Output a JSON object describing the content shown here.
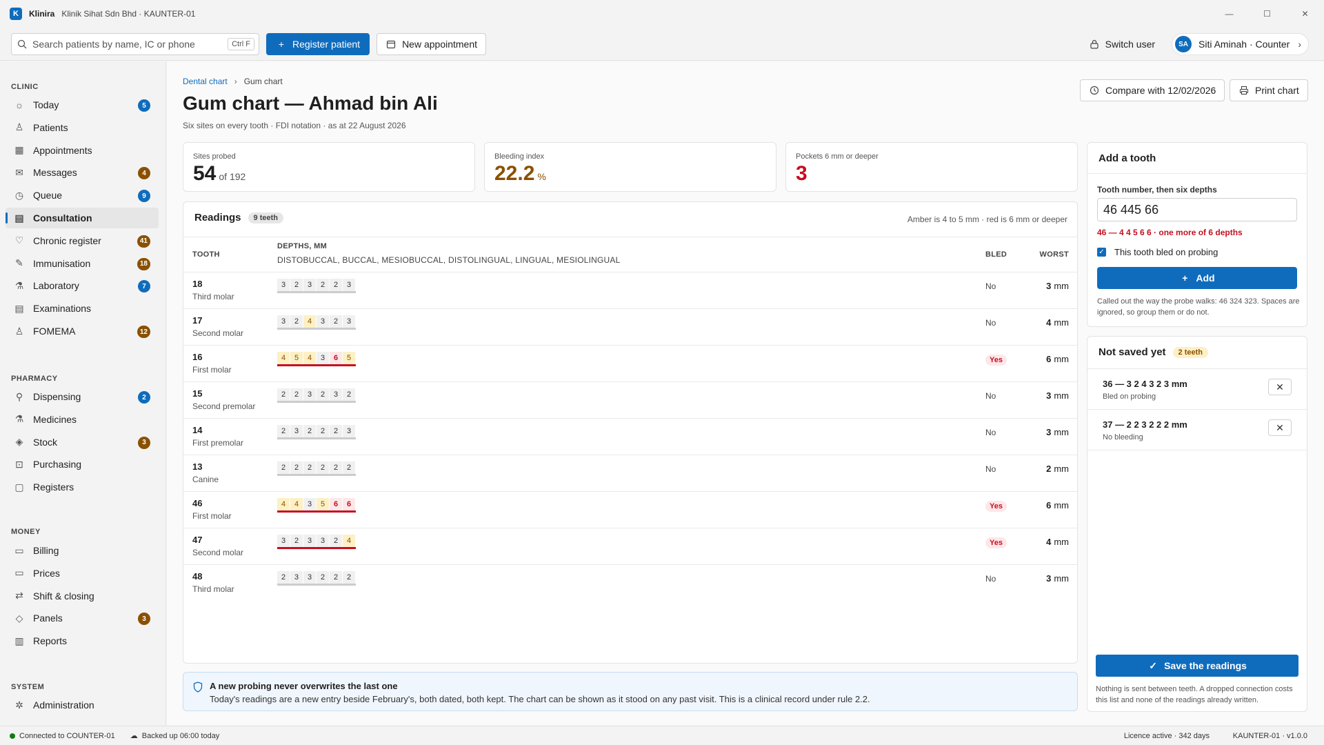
{
  "app": {
    "name": "Klinira",
    "subtitle": "Klinik Sihat Sdn Bhd · KAUNTER-01",
    "logo_letter": "K"
  },
  "toolbar": {
    "search_placeholder": "Search patients by name, IC or phone",
    "search_shortcut": "Ctrl F",
    "register_label": "Register patient",
    "appointment_label": "New appointment",
    "switch_user_label": "Switch user",
    "user_initials": "SA",
    "user_label": "Siti Aminah · Counter"
  },
  "sidebar": {
    "sections": [
      {
        "title": "CLINIC",
        "items": [
          {
            "label": "Today",
            "badge": "5",
            "badge_color": "blue"
          },
          {
            "label": "Patients"
          },
          {
            "label": "Appointments"
          },
          {
            "label": "Messages",
            "badge": "4",
            "badge_color": "brown"
          },
          {
            "label": "Queue",
            "badge": "9",
            "badge_color": "blue"
          },
          {
            "label": "Consultation",
            "active": true
          },
          {
            "label": "Chronic register",
            "badge": "41",
            "badge_color": "brown"
          },
          {
            "label": "Immunisation",
            "badge": "18",
            "badge_color": "brown"
          },
          {
            "label": "Laboratory",
            "badge": "7",
            "badge_color": "blue"
          },
          {
            "label": "Examinations"
          },
          {
            "label": "FOMEMA",
            "badge": "12",
            "badge_color": "brown"
          }
        ]
      },
      {
        "title": "PHARMACY",
        "items": [
          {
            "label": "Dispensing",
            "badge": "2",
            "badge_color": "blue"
          },
          {
            "label": "Medicines"
          },
          {
            "label": "Stock",
            "badge": "3",
            "badge_color": "brown"
          },
          {
            "label": "Purchasing"
          },
          {
            "label": "Registers"
          }
        ]
      },
      {
        "title": "MONEY",
        "items": [
          {
            "label": "Billing"
          },
          {
            "label": "Prices"
          },
          {
            "label": "Shift & closing"
          },
          {
            "label": "Panels",
            "badge": "3",
            "badge_color": "brown"
          },
          {
            "label": "Reports"
          }
        ]
      },
      {
        "title": "SYSTEM",
        "items": [
          {
            "label": "Administration"
          }
        ]
      }
    ]
  },
  "page": {
    "breadcrumb": [
      "Dental chart",
      "Gum chart"
    ],
    "title": "Gum chart — Ahmad bin Ali",
    "subtitle": "Six sites on every tooth · FDI notation · as at 22 August 2026",
    "compare_label": "Compare with 12/02/2026",
    "print_label": "Print chart"
  },
  "stats": {
    "sites_label": "Sites probed",
    "sites_value": "54",
    "sites_suffix": "of 192",
    "bleeding_label": "Bleeding index",
    "bleeding_value": "22.2",
    "bleeding_suffix": "%",
    "pockets_label": "Pockets 6 mm or deeper",
    "pockets_value": "3"
  },
  "readings": {
    "title": "Readings",
    "count_pill": "9 teeth",
    "legend": "Amber is 4 to 5 mm · red is 6 mm or deeper",
    "col_tooth": "TOOTH",
    "col_depths": "DEPTHS, MM",
    "col_depths_sub": "DISTOBUCCAL, BUCCAL, MESIOBUCCAL, DISTOLINGUAL, LINGUAL, MESIOLINGUAL",
    "col_bled": "BLED",
    "col_worst": "WORST",
    "rows": [
      {
        "tooth": "18",
        "name": "Third molar",
        "depths": [
          3,
          2,
          3,
          2,
          2,
          3
        ],
        "bled": "No",
        "worst": "3",
        "unit": "mm"
      },
      {
        "tooth": "17",
        "name": "Second molar",
        "depths": [
          3,
          2,
          4,
          3,
          2,
          3
        ],
        "bled": "No",
        "worst": "4",
        "unit": "mm"
      },
      {
        "tooth": "16",
        "name": "First molar",
        "depths": [
          4,
          5,
          4,
          3,
          6,
          5
        ],
        "bled": "Yes",
        "worst": "6",
        "unit": "mm"
      },
      {
        "tooth": "15",
        "name": "Second premolar",
        "depths": [
          2,
          2,
          3,
          2,
          3,
          2
        ],
        "bled": "No",
        "worst": "3",
        "unit": "mm"
      },
      {
        "tooth": "14",
        "name": "First premolar",
        "depths": [
          2,
          3,
          2,
          2,
          2,
          3
        ],
        "bled": "No",
        "worst": "3",
        "unit": "mm"
      },
      {
        "tooth": "13",
        "name": "Canine",
        "depths": [
          2,
          2,
          2,
          2,
          2,
          2
        ],
        "bled": "No",
        "worst": "2",
        "unit": "mm"
      },
      {
        "tooth": "46",
        "name": "First molar",
        "depths": [
          4,
          4,
          3,
          5,
          6,
          6
        ],
        "bled": "Yes",
        "worst": "6",
        "unit": "mm"
      },
      {
        "tooth": "47",
        "name": "Second molar",
        "depths": [
          3,
          2,
          3,
          3,
          2,
          4
        ],
        "bled": "Yes",
        "worst": "4",
        "unit": "mm"
      },
      {
        "tooth": "48",
        "name": "Third molar",
        "depths": [
          2,
          3,
          3,
          2,
          2,
          2
        ],
        "bled": "No",
        "worst": "3",
        "unit": "mm"
      }
    ]
  },
  "notice": {
    "title": "A new probing never overwrites the last one",
    "body": "Today's readings are a new entry beside February's, both dated, both kept. The chart can be shown as it stood on any past visit. This is a clinical record under rule 2.2."
  },
  "add_tooth": {
    "title": "Add a tooth",
    "field_label": "Tooth number, then six depths",
    "field_value": "46 445 66",
    "error": "46 — 4 4 5 6 6 ·  one more of 6 depths",
    "bled_label": "This tooth bled on probing",
    "bled_checked": true,
    "add_label": "Add",
    "help": "Called out the way the probe walks: 46 324 323. Spaces are ignored, so group them or do not."
  },
  "pending": {
    "title": "Not saved yet",
    "count_pill": "2 teeth",
    "items": [
      {
        "title": "36 — 3 2 4 3 2 3 mm",
        "sub": "Bled on probing"
      },
      {
        "title": "37 — 2 2 3 2 2 2 mm",
        "sub": "No bleeding"
      }
    ],
    "save_label": "Save the readings",
    "save_help": "Nothing is sent between teeth. A dropped connection costs this list and none of the readings already written."
  },
  "status": {
    "connection": "Connected to COUNTER-01",
    "backup": "Backed up 06:00 today",
    "licence": "Licence active · 342 days",
    "version": "KAUNTER-01 · v1.0.0"
  },
  "colors": {
    "accent": "#0f6cbd",
    "amber": "#8a5000",
    "red": "#c50f1f",
    "badge_brown": "#8a5000"
  }
}
